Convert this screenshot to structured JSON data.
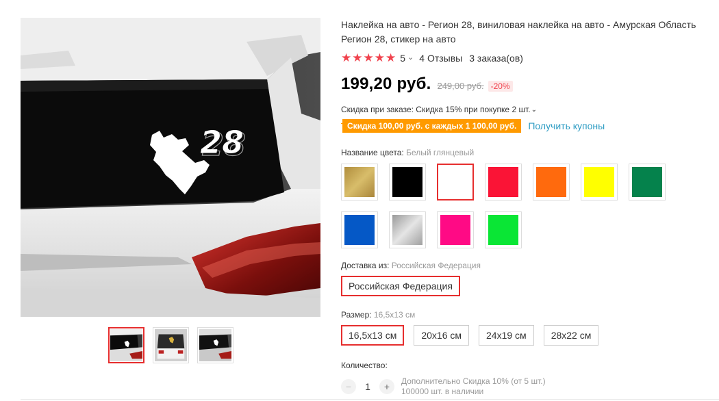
{
  "product": {
    "title": "Наклейка на авто - Регион 28, виниловая наклейка на авто - Амурская Область Регион 28, стикер на авто",
    "image_label": "28",
    "rating": {
      "stars": 5,
      "value": "5",
      "reviews": "4 Отзывы",
      "orders": "3 заказа(ов)"
    },
    "price": {
      "current": "199,20 руб.",
      "old": "249,00 руб.",
      "discount": "-20%"
    },
    "order_discount": "Скидка при заказе: Скидка 15% при покупке 2 шт.",
    "coupon": {
      "badge": "Скидка 100,00 руб. с каждых 1 100,00 руб.",
      "link": "Получить купоны"
    }
  },
  "color": {
    "label": "Название цвета:",
    "selected": "Белый глянцевый",
    "swatches": [
      {
        "name": "gold",
        "fill": "linear-gradient(135deg,#b08d3c,#d8bd6a 50%,#a9853a)",
        "selected": false
      },
      {
        "name": "black",
        "fill": "#000000",
        "selected": false
      },
      {
        "name": "white",
        "fill": "#ffffff",
        "selected": true
      },
      {
        "name": "red",
        "fill": "#fa1436",
        "selected": false
      },
      {
        "name": "orange",
        "fill": "#ff6a0d",
        "selected": false
      },
      {
        "name": "yellow",
        "fill": "#ffff00",
        "selected": false
      },
      {
        "name": "green",
        "fill": "#05824c",
        "selected": false
      },
      {
        "name": "blue",
        "fill": "#0558c6",
        "selected": false
      },
      {
        "name": "silver",
        "fill": "linear-gradient(135deg,#9a9a9a,#e5e5e5 50%,#a0a0a0)",
        "selected": false
      },
      {
        "name": "pink",
        "fill": "#ff0a85",
        "selected": false
      },
      {
        "name": "light-green",
        "fill": "#0ae635",
        "selected": false
      }
    ]
  },
  "shipping": {
    "label": "Доставка из:",
    "selected": "Российская Федерация",
    "option": "Российская Федерация"
  },
  "size": {
    "label": "Размер:",
    "selected": "16,5x13 см",
    "options": [
      "16,5x13 см",
      "20x16 см",
      "24x19 см",
      "28x22 см"
    ]
  },
  "quantity": {
    "label": "Количество:",
    "minus": "−",
    "value": "1",
    "plus": "+",
    "extra_discount": "Дополнительно Скидка 10% (от 5 шт.)",
    "stock": "100000 шт. в наличии"
  },
  "icons": {
    "star": "★",
    "chevron": "⌄"
  },
  "colors": {
    "accent": "#e62e2e",
    "star": "#f0424d",
    "coupon": "#ff9a00",
    "link": "#2e9cc3"
  }
}
